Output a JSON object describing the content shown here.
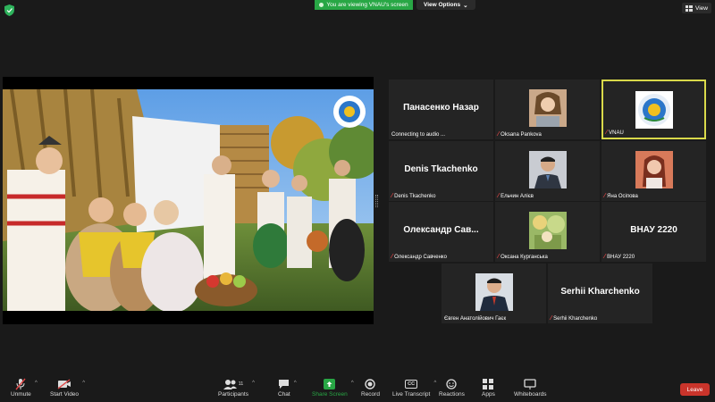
{
  "top": {
    "share_banner": "You are viewing VNAU's screen",
    "view_options": "View Options",
    "view": "View"
  },
  "gallery": [
    {
      "name": "Панасенко Назар",
      "label": "Connecting to audio ...",
      "muted": false,
      "type": "name"
    },
    {
      "name": "",
      "label": "Oksana Pankova",
      "muted": true,
      "type": "photo"
    },
    {
      "name": "",
      "label": "VNAU",
      "muted": true,
      "type": "logo",
      "active": true
    },
    {
      "name": "Denis Tkachenko",
      "label": "Denis Tkachenko",
      "muted": true,
      "type": "name"
    },
    {
      "name": "",
      "label": "Ельчин Алієв",
      "muted": true,
      "type": "photo"
    },
    {
      "name": "",
      "label": "Яна Осіпова",
      "muted": true,
      "type": "photo"
    },
    {
      "name": "Олександр  Сав...",
      "label": "Олександр Савченко",
      "muted": true,
      "type": "name"
    },
    {
      "name": "",
      "label": "Оксана Курганська",
      "muted": true,
      "type": "photo"
    },
    {
      "name": "ВНАУ 2220",
      "label": "ВНАУ 2220",
      "muted": true,
      "type": "name"
    },
    {
      "name": "",
      "label": "Євген Анатолійович Гаєк",
      "muted": false,
      "type": "photo"
    },
    {
      "name": "Serhii Kharchenko",
      "label": "Serhii Kharchenko",
      "muted": true,
      "type": "name"
    }
  ],
  "toolbar": {
    "unmute": "Unmute",
    "start_video": "Start Video",
    "participants": "Participants",
    "participants_count": "11",
    "chat": "Chat",
    "share_screen": "Share Screen",
    "record": "Record",
    "live_transcript": "Live Transcript",
    "cc": "CC",
    "reactions": "Reactions",
    "apps": "Apps",
    "whiteboards": "Whiteboards",
    "leave": "Leave"
  },
  "colors": {
    "share_green": "#28a745",
    "leave_red": "#c9342b",
    "active_speaker": "#d9d94a",
    "tile_bg": "#242424"
  }
}
